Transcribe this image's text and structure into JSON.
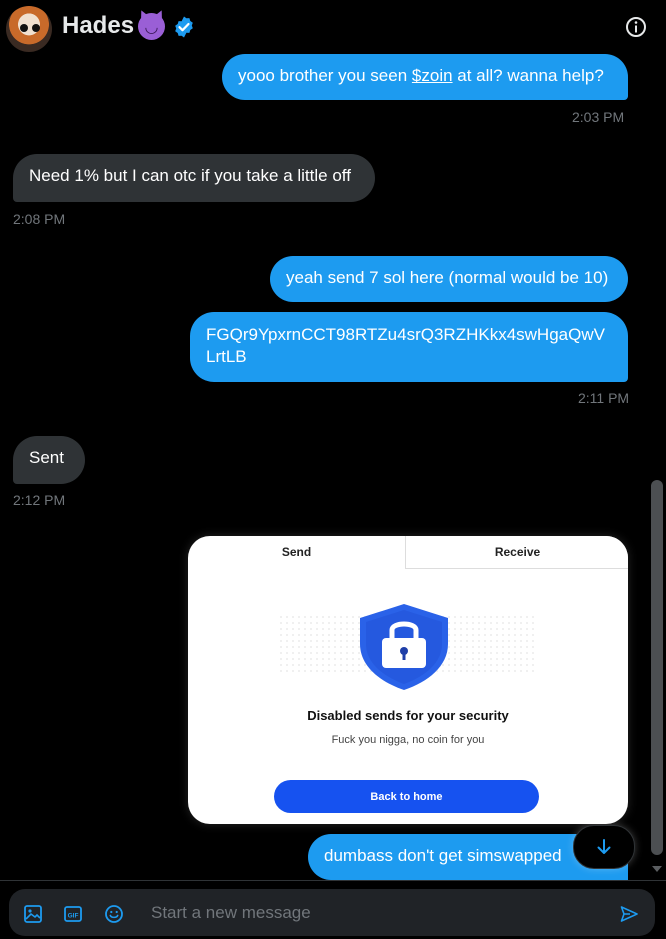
{
  "header": {
    "name": "Hades",
    "emoji": "😈"
  },
  "messages": [
    {
      "dir": "out",
      "text_pre": "yooo brother you seen ",
      "link": "$zoin",
      "text_post": " at all? wanna help?"
    },
    {
      "dir": "in",
      "text": "Need 1% but I can otc if you take a little off"
    },
    {
      "dir": "out",
      "text": "yeah send 7 sol here (normal would be 10)"
    },
    {
      "dir": "out",
      "text": "FGQr9YpxrnCCT98RTZu4srQ3RZHKkx4swHgaQwV LrtLB"
    },
    {
      "dir": "in",
      "text": "Sent"
    },
    {
      "dir": "out",
      "text": "dumbass don't get simswapped"
    }
  ],
  "timestamps": [
    "2:03 PM",
    "2:08 PM",
    "2:11 PM",
    "2:12 PM"
  ],
  "image": {
    "tab_send": "Send",
    "tab_receive": "Receive",
    "heading": "Disabled sends for your security",
    "subtext": "Fuck you nigga, no coin for you",
    "button": "Back to home"
  },
  "composer": {
    "placeholder": "Start a new message"
  },
  "colors": {
    "accent": "#1d9bf0",
    "incoming": "#2f3336",
    "background": "#000000",
    "wallet_blue": "#1652f0"
  },
  "icons": [
    "info-icon",
    "verified-badge-icon",
    "image-icon",
    "gif-icon",
    "emoji-icon",
    "send-icon",
    "arrow-down-icon"
  ]
}
